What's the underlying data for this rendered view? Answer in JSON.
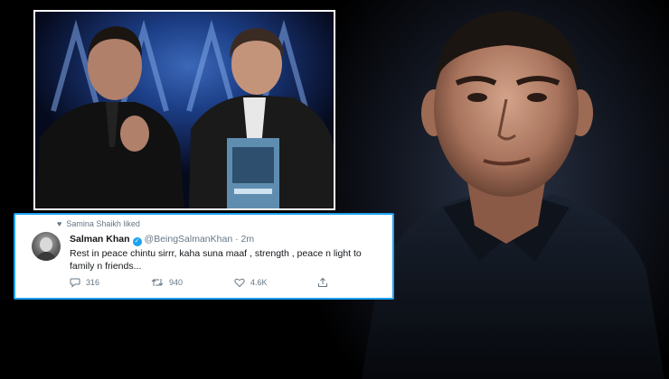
{
  "tweet": {
    "liked_by": "Samina Shaikh liked",
    "user_name": "Salman Khan",
    "handle": "@BeingSalmanKhan",
    "separator": "·",
    "time": "2m",
    "text": "Rest in peace chintu sirrr,  kaha suna maaf , strength , peace n light to family n friends...",
    "reply_count": "316",
    "retweet_count": "940",
    "like_count": "4.6K"
  },
  "icons": {
    "liked": "heart-icon",
    "verified": "verified-badge-icon",
    "reply": "comment-icon",
    "retweet": "retweet-icon",
    "like": "heart-icon",
    "share": "share-icon"
  },
  "colors": {
    "tweet_border": "#1da1f2",
    "background": "#000000",
    "verified": "#1da1f2",
    "muted_text": "#657786"
  }
}
